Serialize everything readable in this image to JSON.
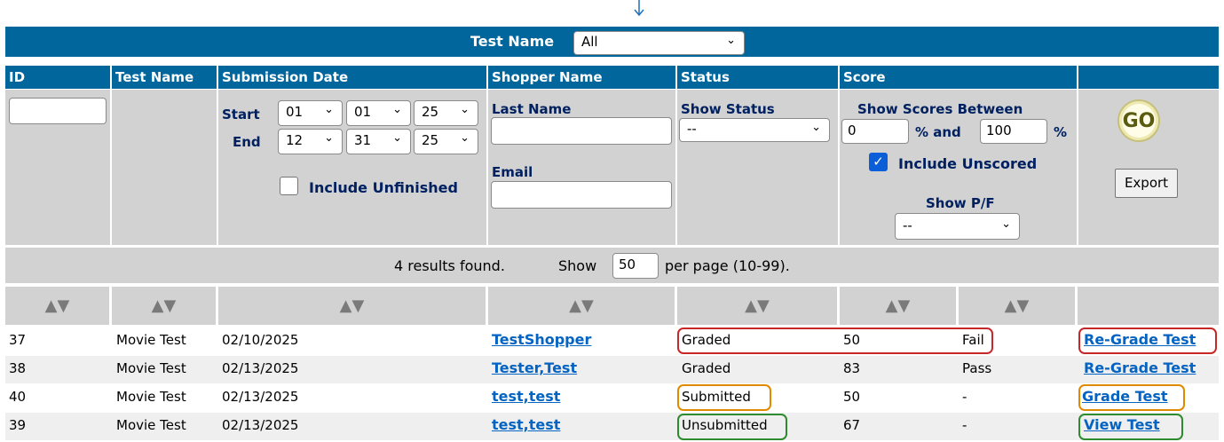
{
  "arrow_icon": "down-arrow-icon",
  "title_bar": {
    "label": "Test Name",
    "select_value": "All"
  },
  "headers": [
    "ID",
    "Test Name",
    "Submission Date",
    "Shopper Name",
    "Status",
    "Score"
  ],
  "filters": {
    "start_label": "Start",
    "end_label": "End",
    "start": {
      "month": "01",
      "day": "01",
      "year": "25"
    },
    "end": {
      "month": "12",
      "day": "31",
      "year": "25"
    },
    "include_unfinished": "Include Unfinished",
    "last_name_label": "Last Name",
    "email_label": "Email",
    "show_status_label": "Show Status",
    "show_status_value": "--",
    "scores_between_label": "Show Scores Between",
    "score_min": "0",
    "and_label": "% and",
    "score_max": "100",
    "pct_label": "%",
    "include_unscored": "Include Unscored",
    "show_pf_label": "Show P/F",
    "show_pf_value": "--",
    "go_label": "GO",
    "export_label": "Export"
  },
  "results": {
    "found_text": "4 results found.",
    "show_label": "Show",
    "per_page_value": "50",
    "per_page_text": "per page (10-99)."
  },
  "sort_glyph": "▲▼",
  "rows": [
    {
      "id": "37",
      "test": "Movie Test",
      "date": "02/10/2025",
      "shopper": "TestShopper",
      "status": "Graded",
      "score": "50",
      "pf": "Fail",
      "action": "Re-Grade Test"
    },
    {
      "id": "38",
      "test": "Movie Test",
      "date": "02/13/2025",
      "shopper": "Tester,Test",
      "status": "Graded",
      "score": "83",
      "pf": "Pass",
      "action": "Re-Grade Test"
    },
    {
      "id": "40",
      "test": "Movie Test",
      "date": "02/13/2025",
      "shopper": "test,test",
      "status": "Submitted",
      "score": "50",
      "pf": "-",
      "action": "Grade Test"
    },
    {
      "id": "39",
      "test": "Movie Test",
      "date": "02/13/2025",
      "shopper": "test,test",
      "status": "Unsubmitted",
      "score": "67",
      "pf": "-",
      "action": "View Test"
    }
  ],
  "colors": {
    "header": "#00669c",
    "panel": "#d2d2d2",
    "link": "#0563c1",
    "highlight_red": "#c62828",
    "highlight_orange": "#e08a00",
    "highlight_green": "#2e8b2e"
  }
}
